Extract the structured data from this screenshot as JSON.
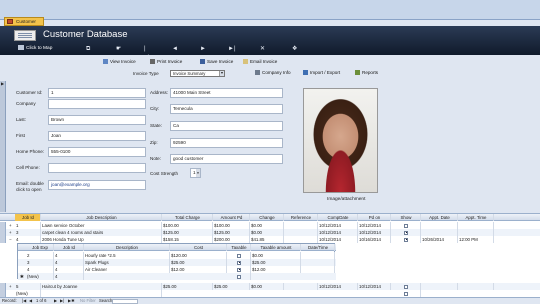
{
  "tab": {
    "label": "Customer"
  },
  "header": {
    "title": "Customer Database",
    "click_to_map": "Click to Map",
    "nav": [
      "⧉",
      "☛",
      "|◄",
      "◄",
      "►",
      "►|",
      "✕",
      "❖"
    ]
  },
  "toolbar": {
    "view_invoice": "View Invoice",
    "print_invoice": "Print Invoice",
    "save_invoice": "Save Invoice",
    "email_invoice": "Email Invoice",
    "invoice_type_label": "Invoice Type",
    "invoice_type_value": "Invoice Summary",
    "company_info": "Company Info",
    "import_export": "Import / Export",
    "reports": "Reports"
  },
  "form": {
    "customer_id": {
      "label": "Customer Id:",
      "value": "1"
    },
    "company": {
      "label": "Company",
      "value": ""
    },
    "last": {
      "label": "Last:",
      "value": "Brown"
    },
    "first": {
      "label": "First",
      "value": "Joan"
    },
    "home_phone": {
      "label": "Home Phone:",
      "value": "555-0100"
    },
    "cell_phone": {
      "label": "Cell Phone:",
      "value": ""
    },
    "email": {
      "label": "Email: double click to open",
      "value": "joan@example.org"
    },
    "address": {
      "label": "Address:",
      "value": "41000 Main Street"
    },
    "city": {
      "label": "City:",
      "value": "Temecula"
    },
    "state": {
      "label": "State:",
      "value": "Ca"
    },
    "zip": {
      "label": "Zip:",
      "value": "92590"
    },
    "note": {
      "label": "Note:",
      "value": "good customer"
    },
    "cost_strength": {
      "label": "Cost Strength",
      "value": "1"
    },
    "photo_caption": "Image/attachment"
  },
  "grid": {
    "columns": [
      "Job Id",
      "Job Description",
      "Total Charge",
      "Amount Pd",
      "Change",
      "Reference",
      "CompDate",
      "Pd on",
      "Show",
      "Appt. Date",
      "Appt. Time"
    ],
    "rows": [
      {
        "exp": "+",
        "id": "1",
        "desc": "Lawn service October",
        "total": "$100.00",
        "paid": "$100.00",
        "change": "$0.00",
        "ref": "",
        "comp": "10/12/2014",
        "pdon": "10/12/2014",
        "show": false,
        "adate": "",
        "atime": ""
      },
      {
        "exp": "+",
        "id": "3",
        "desc": "carpet clean 4 rooms and stairs",
        "total": "$125.00",
        "paid": "$125.00",
        "change": "$0.00",
        "ref": "",
        "comp": "10/12/2014",
        "pdon": "10/12/2014",
        "show": true,
        "adate": "",
        "atime": ""
      },
      {
        "exp": "−",
        "id": "4",
        "desc": "2006 Honda Tune Up",
        "total": "$158.15",
        "paid": "$200.00",
        "change": "$41.85",
        "ref": "",
        "comp": "10/12/2014",
        "pdon": "10/16/2014",
        "show": true,
        "adate": "10/26/2014",
        "atime": "12:00 PM"
      },
      {
        "exp": "+",
        "id": "5",
        "desc": "Haircut by Joanne",
        "total": "$25.00",
        "paid": "$25.00",
        "change": "$0.00",
        "ref": "",
        "comp": "10/12/2014",
        "pdon": "10/12/2014",
        "show": false,
        "adate": "",
        "atime": ""
      },
      {
        "exp": "",
        "id": "(New)",
        "desc": "",
        "total": "",
        "paid": "",
        "change": "",
        "ref": "",
        "comp": "",
        "pdon": "",
        "show": false,
        "adate": "",
        "atime": ""
      }
    ]
  },
  "sub": {
    "columns": [
      "Job Exp",
      "Job Id",
      "Description",
      "Cost",
      "Taxable",
      "Taxable amount",
      "Date/Time"
    ],
    "rows": [
      {
        "exp": "2",
        "jobid": "4",
        "desc": "Hourly rate *2.5",
        "cost": "$120.00",
        "taxable": false,
        "taxamt": "$0.00",
        "dt": ""
      },
      {
        "exp": "3",
        "jobid": "4",
        "desc": "Spark Plugs",
        "cost": "$25.00",
        "taxable": true,
        "taxamt": "$25.00",
        "dt": ""
      },
      {
        "exp": "4",
        "jobid": "4",
        "desc": "Air Cleaner",
        "cost": "$12.00",
        "taxable": true,
        "taxamt": "$12.00",
        "dt": ""
      },
      {
        "exp": "(New)",
        "jobid": "4",
        "desc": "",
        "cost": "",
        "taxable": false,
        "taxamt": "",
        "dt": ""
      }
    ]
  },
  "recnav": {
    "record_label": "Record:",
    "position": "1 of 6",
    "no_filter": "No Filter",
    "search": "Search"
  }
}
